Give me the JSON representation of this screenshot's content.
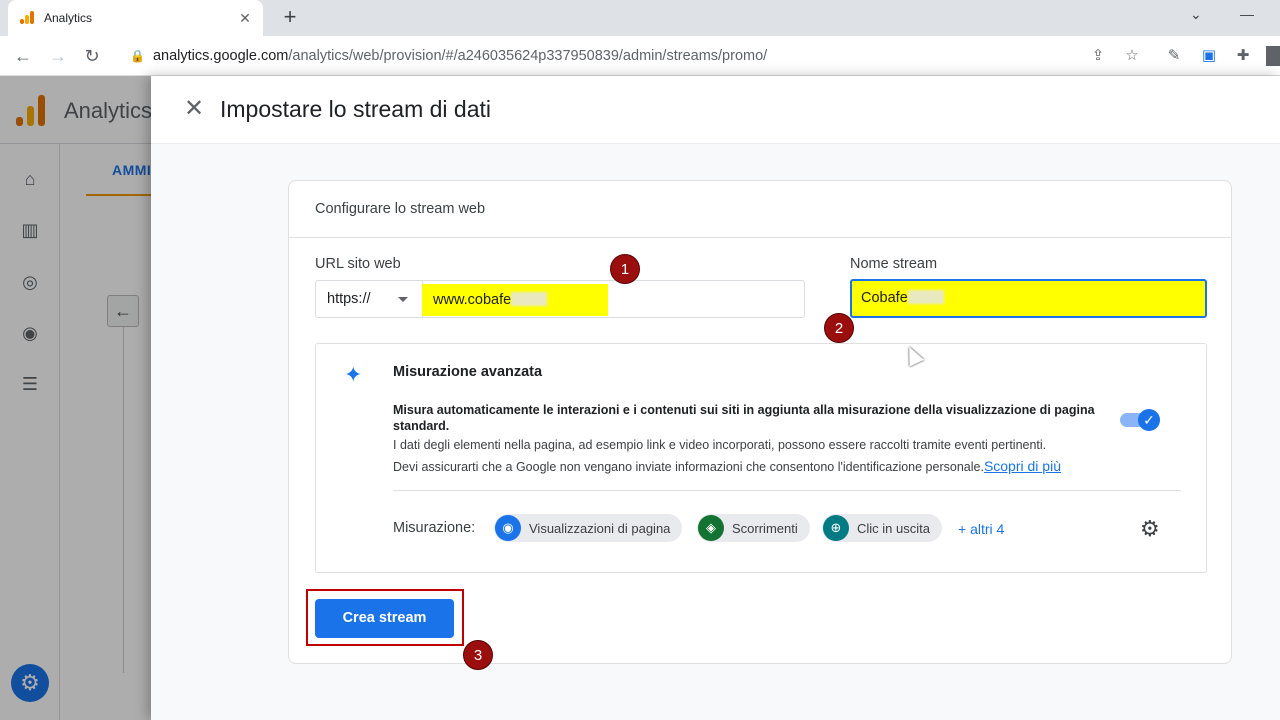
{
  "browser": {
    "tab_title": "Analytics",
    "tab_close": "✕",
    "new_tab": "+",
    "url_host": "analytics.google.com",
    "url_path": "/analytics/web/provision/#/a246035624p337950839/admin/streams/promo/"
  },
  "app": {
    "name": "Analytics",
    "admin_tab": "AMMI"
  },
  "panel": {
    "title": "Impostare lo stream di dati",
    "card_title": "Configurare lo stream web",
    "url_label": "URL sito web",
    "protocol": "https://",
    "url_value": "www.cobafe",
    "stream_name_label": "Nome stream",
    "stream_name_value": "Cobafe",
    "advanced": {
      "title": "Misurazione avanzata",
      "description_bold": "Misura automaticamente le interazioni e i contenuti sui siti in aggiunta alla misurazione della visualizzazione di pagina standard.",
      "description_1": "I dati degli elementi nella pagina, ad esempio link e video incorporati, possono essere raccolti tramite eventi pertinenti.",
      "description_2": "Devi assicurarti che a Google non vengano inviate informazioni che consentono l'identificazione personale.",
      "learn_more": "Scopri di più",
      "toggle_on": true,
      "measurement_label": "Misurazione:",
      "chips": [
        "Visualizzazioni di pagina",
        "Scorrimenti",
        "Clic in uscita"
      ],
      "more": "+ altri 4"
    },
    "create_button": "Crea stream"
  },
  "annotations": {
    "badge_1": "1",
    "badge_2": "2",
    "badge_3": "3"
  },
  "colors": {
    "accent": "#1a73e8",
    "highlight": "#ffff00",
    "annotation_red": "#9b0e0e",
    "outline_red": "#c00000"
  }
}
